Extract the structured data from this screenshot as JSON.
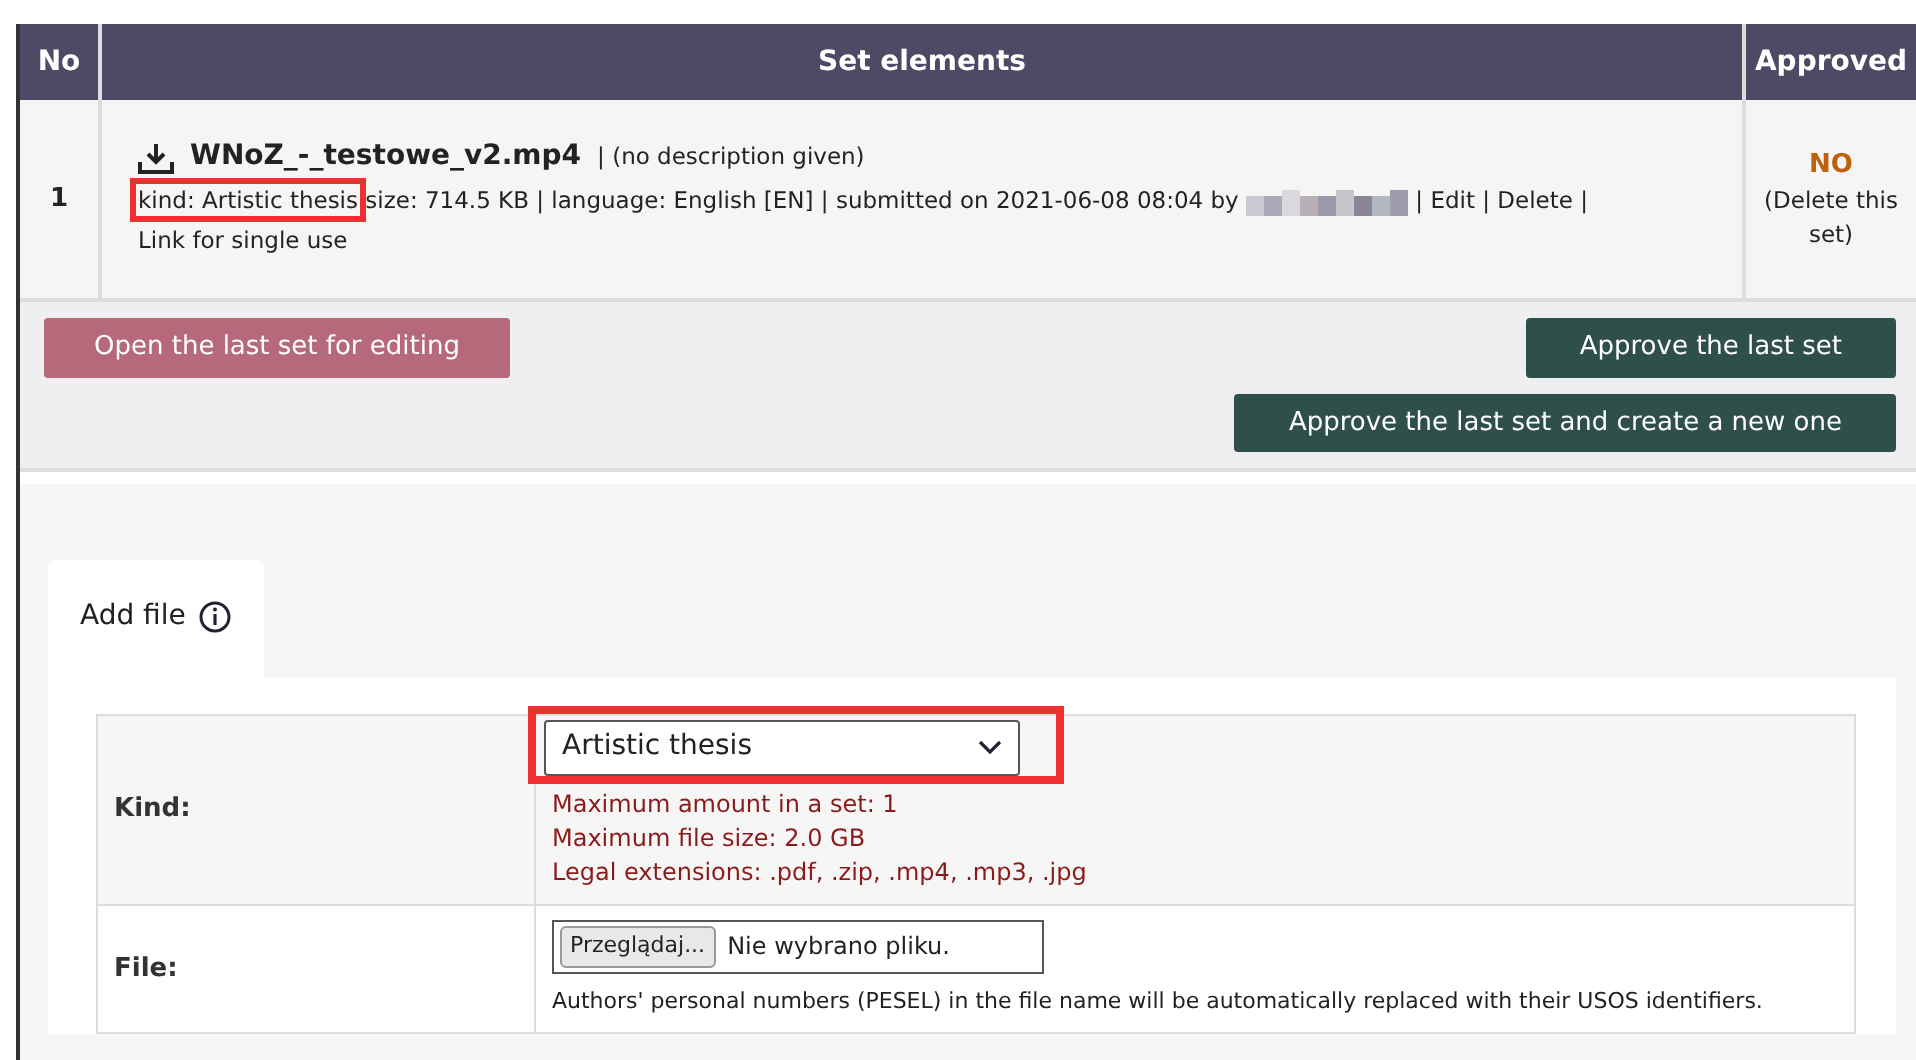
{
  "table": {
    "columns": [
      "No",
      "Set elements",
      "Approved"
    ],
    "rows": [
      {
        "no": "1",
        "file_name": "WNoZ_-_testowe_v2.mp4",
        "description": "| (no description given)",
        "kind_text": "kind: Artistic thesis",
        "kind_highlighted": true,
        "details": "size: 714.5 KB | language: English [EN] | submitted on 2021-06-08 08:04 by",
        "author_redacted": true,
        "separator": "|",
        "links": [
          "Edit",
          "Delete",
          "Link for single use"
        ],
        "approved": "NO",
        "approved_note": "(Delete this set)"
      }
    ]
  },
  "actions": [
    {
      "label": "Open the last set for editing",
      "kind": "secondary"
    },
    {
      "label": "Approve the last set",
      "kind": "primary"
    },
    {
      "label": "Approve the last set and create a new one",
      "kind": "primary"
    }
  ],
  "tabs": [
    {
      "label": "Add file",
      "selected": true
    }
  ],
  "form": {
    "fields": [
      {
        "kind": "select",
        "label": "Kind:",
        "value": "Artistic thesis",
        "highlighted": true,
        "notes": [
          "Maximum amount in a set: 1",
          "Maximum file size: 2.0 GB",
          "Legal extensions: .pdf, .zip, .mp4, .mp3, .jpg"
        ]
      },
      {
        "kind": "file",
        "label": "File:",
        "button": "Przeglądaj...",
        "value": "Nie wybrano pliku.",
        "hint": "Authors' personal numbers (PESEL) in the file name will be automatically replaced with their USOS identifiers."
      }
    ]
  }
}
